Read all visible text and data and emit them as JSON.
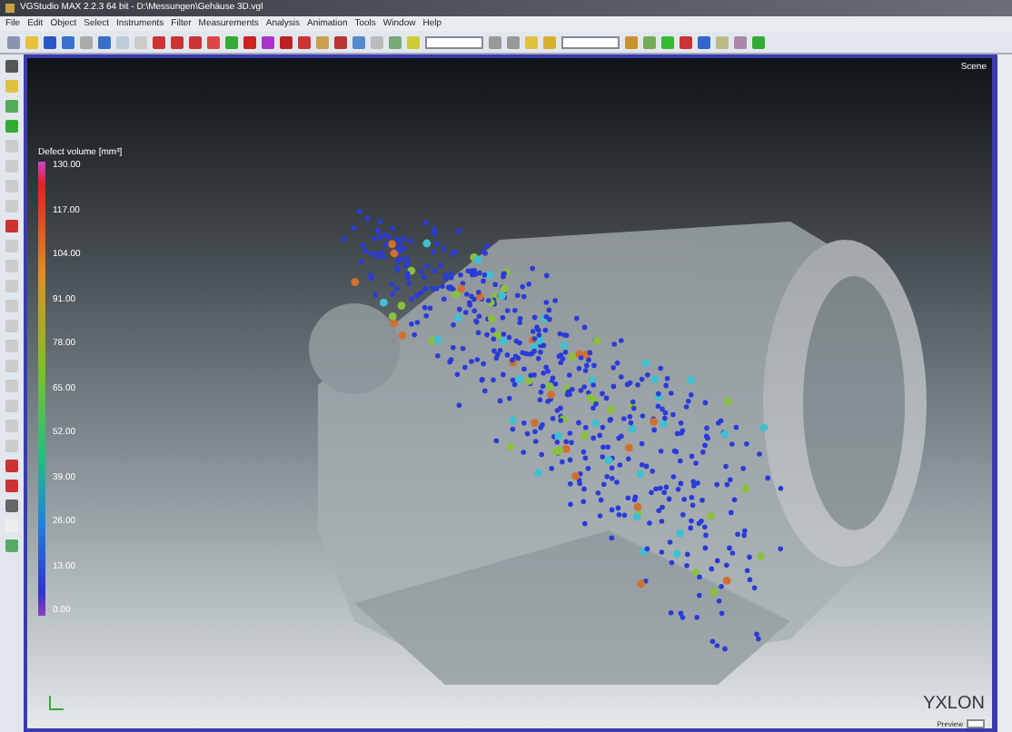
{
  "window": {
    "title": "VGStudio MAX 2.2.3 64 bit - D:\\Messungen\\Gehäuse 3D.vgl"
  },
  "menu": [
    "File",
    "Edit",
    "Object",
    "Select",
    "Instruments",
    "Filter",
    "Measurements",
    "Analysis",
    "Animation",
    "Tools",
    "Window",
    "Help"
  ],
  "viewport": {
    "label": "Scene",
    "legend": {
      "title": "Defect volume [mm³]",
      "labels": [
        "130.00",
        "117.00",
        "104.00",
        "91.00",
        "78.00",
        "65.00",
        "52.00",
        "39.00",
        "26.00",
        "13.00",
        "0.00"
      ]
    },
    "logo": "YXLON",
    "footer_label": "Preview"
  }
}
